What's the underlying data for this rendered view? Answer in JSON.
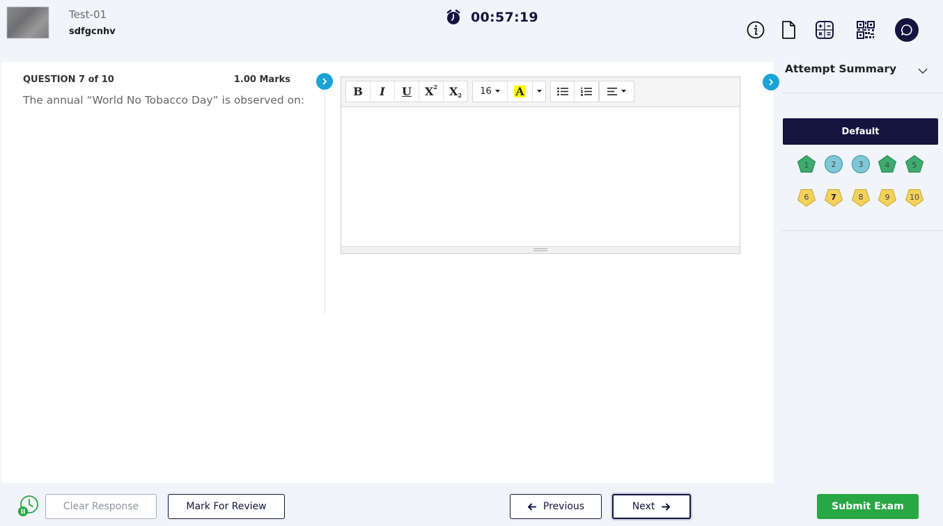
{
  "header": {
    "test_name": "Test-01",
    "user_name": "sdfgcnhv",
    "timer": "00:57:19"
  },
  "question": {
    "heading": "QUESTION 7 of 10",
    "marks": "1.00 Marks",
    "text": "The annual “World No Tobacco Day” is observed on:"
  },
  "editor": {
    "font_size": "16",
    "bold_label": "B",
    "italic_label": "I",
    "underline_label": "U",
    "superscript_label": "X",
    "subscript_label": "X",
    "color_label": "A",
    "highlight_color": "#ffff00"
  },
  "sidebar": {
    "title": "Attempt Summary",
    "section_label": "Default",
    "questions": [
      {
        "num": "1",
        "status": "answered"
      },
      {
        "num": "2",
        "status": "not-answered"
      },
      {
        "num": "3",
        "status": "not-answered"
      },
      {
        "num": "4",
        "status": "answered"
      },
      {
        "num": "5",
        "status": "answered"
      },
      {
        "num": "6",
        "status": "not-visited"
      },
      {
        "num": "7",
        "status": "current"
      },
      {
        "num": "8",
        "status": "not-visited"
      },
      {
        "num": "9",
        "status": "not-visited"
      },
      {
        "num": "10",
        "status": "not-visited"
      }
    ]
  },
  "footer": {
    "clear_label": "Clear Response",
    "mark_label": "Mark For Review",
    "prev_label": "Previous",
    "next_label": "Next",
    "submit_label": "Submit Exam"
  },
  "colors": {
    "navy": "#14143f",
    "accent_blue": "#1aa3d6",
    "green": "#28a745",
    "answered": "#3dab6f",
    "not_answered": "#7ec8d6",
    "not_visited": "#f3d25c"
  },
  "icons": [
    "avatar",
    "alarm-clock-icon",
    "info-icon",
    "document-icon",
    "calculator-icon",
    "qr-code-icon",
    "chat-icon",
    "chevron-right-icon",
    "chevron-down-icon",
    "pause-timer-icon",
    "arrow-left-icon",
    "arrow-right-icon"
  ]
}
